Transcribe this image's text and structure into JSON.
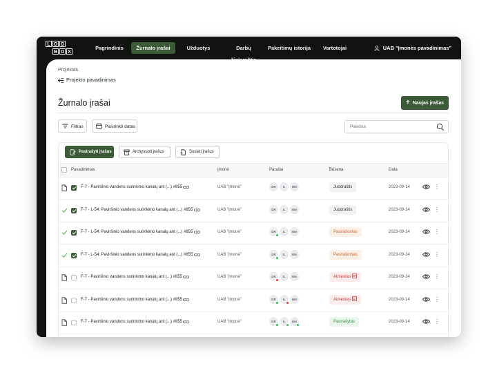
{
  "logo": {
    "letters": [
      "L",
      "O",
      "G",
      "B",
      "O",
      "X"
    ]
  },
  "nav": {
    "items": [
      {
        "label": "Pagrindinis",
        "active": false
      },
      {
        "label": "Žurnalo įrašai",
        "active": true
      },
      {
        "label": "Užduotys",
        "active": false
      },
      {
        "label": "Darbų žiniaraštis",
        "active": false
      },
      {
        "label": "Pakeitimų istorija",
        "active": false
      },
      {
        "label": "Vartotojai",
        "active": false
      }
    ],
    "user": "UAB \"Įmonės pavadinimas\""
  },
  "breadcrumb": {
    "root": "Projektas",
    "back_label": "Projekto pavadinimas"
  },
  "page": {
    "title": "Žurnalo įrašai",
    "new_button": "Naujas įrašas"
  },
  "filters": {
    "filter_label": "Filtras",
    "date_label": "Pasirinkti datas",
    "search_placeholder": "Paieška"
  },
  "tabs": [
    {
      "label": "Pasirašyti įrašus",
      "active": true
    },
    {
      "label": "Archyvuoti įrašus",
      "active": false
    },
    {
      "label": "Susieti įrašus",
      "active": false
    }
  ],
  "table": {
    "headers": {
      "name": "Pavadinimas",
      "company": "Įmonė",
      "signatures": "Parašai",
      "status": "Būsena",
      "date": "Data"
    },
    "rows": [
      {
        "lead": "doc",
        "checked": true,
        "name": "F-7 - Paviršinio vandens surinkimo kanalų ant (...) #855",
        "company": "UAB \"Įmonė\"",
        "sigs": [
          {
            "i": "DR",
            "s": ""
          },
          {
            "i": "IL",
            "s": ""
          },
          {
            "i": "BM",
            "s": ""
          }
        ],
        "status": "Juodraštis",
        "date": "2023-09-14"
      },
      {
        "lead": "check",
        "checked": true,
        "name": "F-7 - L-54: Paviršinio vandens surinkimo kanalų ant (...) #855",
        "company": "UAB \"Įmonė\"",
        "sigs": [
          {
            "i": "DR",
            "s": ""
          },
          {
            "i": "IL",
            "s": ""
          },
          {
            "i": "BM",
            "s": ""
          }
        ],
        "status": "Juodraštis",
        "date": "2023-09-14"
      },
      {
        "lead": "check",
        "checked": true,
        "name": "F-7 - L-54: Paviršinio vandens surinkimo kanalų ant (...) #855",
        "company": "UAB \"Įmonė\"",
        "sigs": [
          {
            "i": "DR",
            "s": "ok"
          },
          {
            "i": "IL",
            "s": ""
          },
          {
            "i": "BM",
            "s": ""
          }
        ],
        "status": "Pasirašomas",
        "date": "2023-09-14"
      },
      {
        "lead": "check",
        "checked": true,
        "name": "F-7 - L-54: Paviršinio vandens surinkimo kanalų ant (...) #855",
        "company": "UAB \"Įmonė\"",
        "sigs": [
          {
            "i": "DR",
            "s": "ok"
          },
          {
            "i": "IL",
            "s": ""
          },
          {
            "i": "BM",
            "s": ""
          }
        ],
        "status": "Pasirašomas",
        "date": "2023-09-14"
      },
      {
        "lead": "doc",
        "checked": false,
        "name": "F-7 - Paviršinio vandens surinkimo kanalų ant (...) #855",
        "company": "UAB \"Įmonė\"",
        "sigs": [
          {
            "i": "DR",
            "s": "no"
          },
          {
            "i": "IL",
            "s": ""
          },
          {
            "i": "BM",
            "s": ""
          }
        ],
        "status": "Atmestas",
        "date": "2023-09-14"
      },
      {
        "lead": "doc",
        "checked": false,
        "name": "F-7 - Paviršinio vandens surinkimo kanalų ant (...) #855",
        "company": "UAB \"Įmonė\"",
        "sigs": [
          {
            "i": "DR",
            "s": "ok"
          },
          {
            "i": "IL",
            "s": "no"
          },
          {
            "i": "BM",
            "s": ""
          }
        ],
        "status": "Atmestas",
        "date": "2023-09-14"
      },
      {
        "lead": "doc",
        "checked": false,
        "name": "F-7 - Paviršinio vandens surinkimo kanalų ant (...) #855",
        "company": "UAB \"Įmonė\"",
        "sigs": [
          {
            "i": "DR",
            "s": "ok"
          },
          {
            "i": "IL",
            "s": "ok"
          },
          {
            "i": "BM",
            "s": "ok"
          }
        ],
        "status": "Pasirašytas",
        "date": "2023-09-14"
      }
    ]
  },
  "colors": {
    "accent": "#3c5a37",
    "ok": "#3fae5a",
    "no": "#d93a3a"
  }
}
